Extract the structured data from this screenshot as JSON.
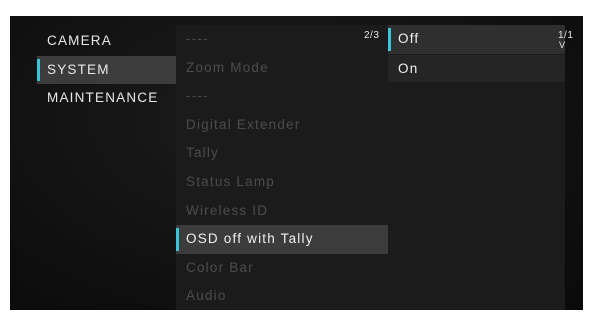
{
  "menu": {
    "categories": [
      {
        "label": "CAMERA",
        "selected": false
      },
      {
        "label": "SYSTEM",
        "selected": true
      },
      {
        "label": "MAINTENANCE",
        "selected": false
      }
    ],
    "system_page_indicator": "2/3",
    "system_items": [
      {
        "label": "----",
        "selected": false
      },
      {
        "label": "Zoom Mode",
        "selected": false
      },
      {
        "label": "----",
        "selected": false
      },
      {
        "label": "Digital Extender",
        "selected": false
      },
      {
        "label": "Tally",
        "selected": false
      },
      {
        "label": "Status Lamp",
        "selected": false
      },
      {
        "label": "Wireless ID",
        "selected": false
      },
      {
        "label": "OSD off with Tally",
        "selected": true
      },
      {
        "label": "Color Bar",
        "selected": false
      },
      {
        "label": "Audio",
        "selected": false
      }
    ],
    "option_page_indicator": "1/1",
    "option_scroll_glyph": "V",
    "options": [
      {
        "label": "Off",
        "selected": true
      },
      {
        "label": "On",
        "selected": false
      }
    ],
    "accent_color": "#39c6d8"
  }
}
